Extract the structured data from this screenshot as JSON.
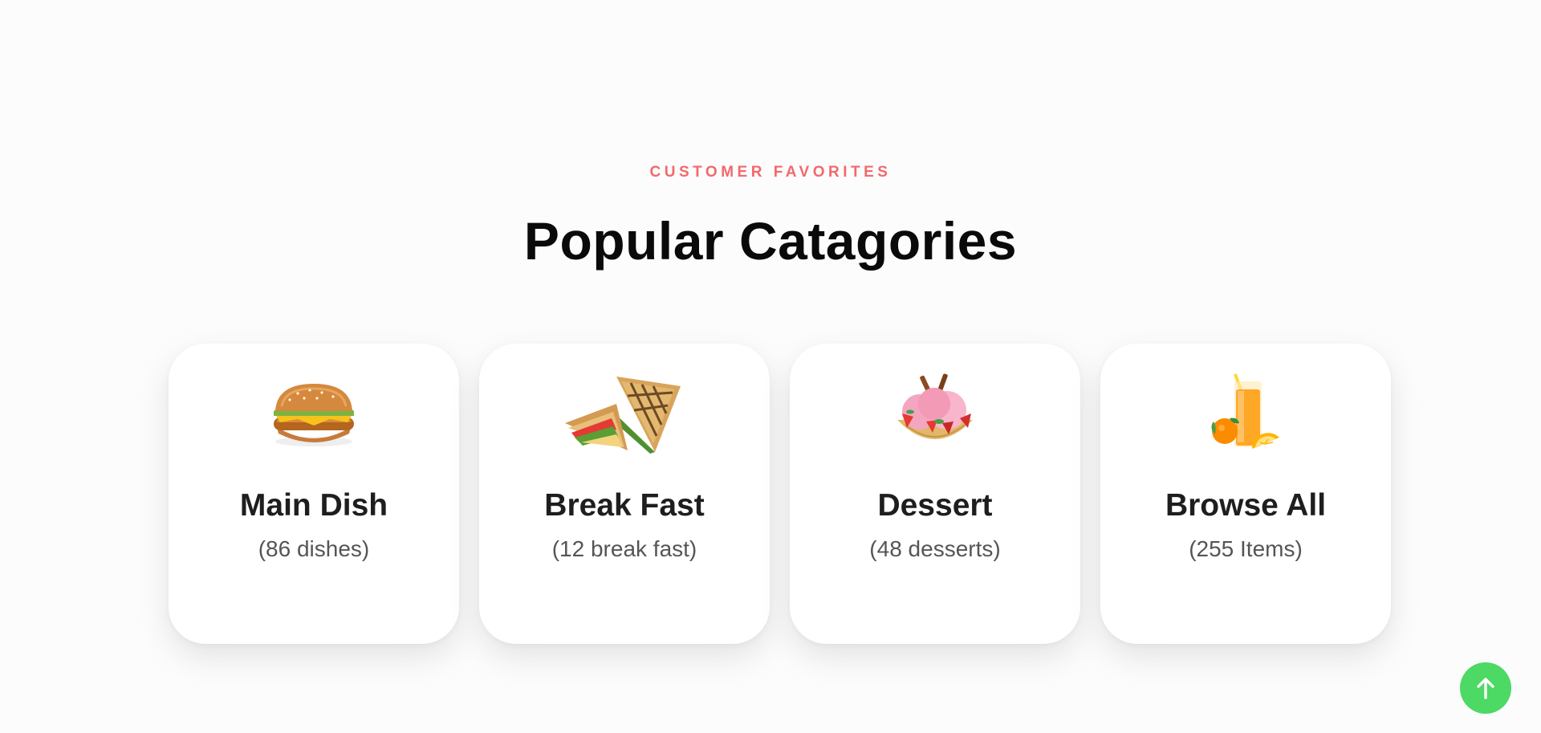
{
  "section": {
    "eyebrow": "CUSTOMER FAVORITES",
    "title": "Popular Catagories"
  },
  "categories": [
    {
      "name": "Main Dish",
      "count": "(86 dishes)",
      "icon": "burger-icon"
    },
    {
      "name": "Break Fast",
      "count": "(12 break fast)",
      "icon": "sandwich-icon"
    },
    {
      "name": "Dessert",
      "count": "(48 desserts)",
      "icon": "ice-cream-icon"
    },
    {
      "name": "Browse All",
      "count": "(255 Items)",
      "icon": "juice-icon"
    }
  ],
  "scroll_top": {
    "icon": "arrow-up-icon"
  },
  "colors": {
    "accent": "#f2696b",
    "scroll_button": "#4cd964",
    "card_bg": "#ffffff",
    "page_bg": "#fcfcfc"
  }
}
